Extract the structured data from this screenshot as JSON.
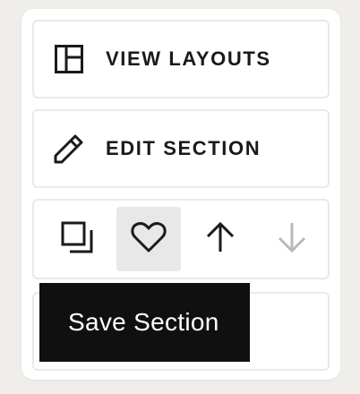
{
  "actions": {
    "view_layouts": {
      "label": "VIEW LAYOUTS",
      "icon": "layout-icon"
    },
    "edit_section": {
      "label": "EDIT SECTION",
      "icon": "pencil-icon"
    }
  },
  "toolbar": {
    "buttons": [
      {
        "name": "duplicate",
        "icon": "duplicate-icon",
        "active": false,
        "enabled": true
      },
      {
        "name": "save",
        "icon": "heart-icon",
        "active": true,
        "enabled": true
      },
      {
        "name": "move-up",
        "icon": "arrow-up-icon",
        "active": false,
        "enabled": true
      },
      {
        "name": "move-down",
        "icon": "arrow-down-icon",
        "active": false,
        "enabled": false
      }
    ]
  },
  "tooltip": {
    "text": "Save Section"
  },
  "colors": {
    "icon": "#1a1a1a",
    "icon_disabled": "#b8b8b8",
    "active_bg": "#e8e8e8",
    "tooltip_bg": "#101010",
    "tooltip_text": "#ffffff",
    "border": "#e9e9e9"
  }
}
